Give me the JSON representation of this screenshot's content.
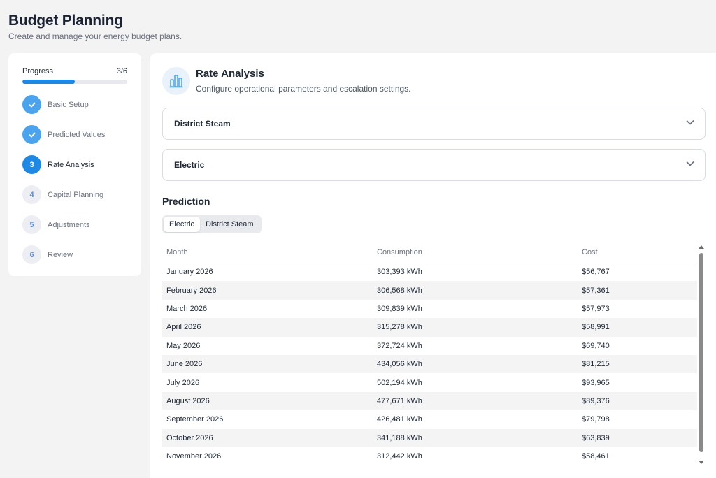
{
  "header": {
    "title": "Budget Planning",
    "subtitle": "Create and manage your energy budget plans."
  },
  "sidebar": {
    "progress_label": "Progress",
    "progress_count": "3/6",
    "progress_fraction": 0.5,
    "steps": [
      {
        "number": "1",
        "label": "Basic Setup",
        "state": "done"
      },
      {
        "number": "2",
        "label": "Predicted Values",
        "state": "done"
      },
      {
        "number": "3",
        "label": "Rate Analysis",
        "state": "active"
      },
      {
        "number": "4",
        "label": "Capital Planning",
        "state": "pending"
      },
      {
        "number": "5",
        "label": "Adjustments",
        "state": "pending"
      },
      {
        "number": "6",
        "label": "Review",
        "state": "pending"
      }
    ]
  },
  "section": {
    "icon": "bar-chart-icon",
    "title": "Rate Analysis",
    "description": "Configure operational parameters and escalation settings."
  },
  "accordions": [
    {
      "label": "District Steam",
      "icon": "chevron-down-icon"
    },
    {
      "label": "Electric",
      "icon": "chevron-down-icon"
    }
  ],
  "prediction": {
    "title": "Prediction",
    "tabs": [
      {
        "label": "Electric",
        "active": true
      },
      {
        "label": "District Steam",
        "active": false
      }
    ],
    "columns": [
      "Month",
      "Consumption",
      "Cost"
    ],
    "rows": [
      [
        "January 2026",
        "303,393 kWh",
        "$56,767"
      ],
      [
        "February 2026",
        "306,568 kWh",
        "$57,361"
      ],
      [
        "March 2026",
        "309,839 kWh",
        "$57,973"
      ],
      [
        "April 2026",
        "315,278 kWh",
        "$58,991"
      ],
      [
        "May 2026",
        "372,724 kWh",
        "$69,740"
      ],
      [
        "June 2026",
        "434,056 kWh",
        "$81,215"
      ],
      [
        "July 2026",
        "502,194 kWh",
        "$93,965"
      ],
      [
        "August 2026",
        "477,671 kWh",
        "$89,376"
      ],
      [
        "September 2026",
        "426,481 kWh",
        "$79,798"
      ],
      [
        "October 2026",
        "341,188 kWh",
        "$63,839"
      ],
      [
        "November 2026",
        "312,442 kWh",
        "$58,461"
      ]
    ]
  },
  "colors": {
    "accent": "#1e88e5",
    "done": "#4aa3ec",
    "icon_bg": "#e9f2fb"
  }
}
